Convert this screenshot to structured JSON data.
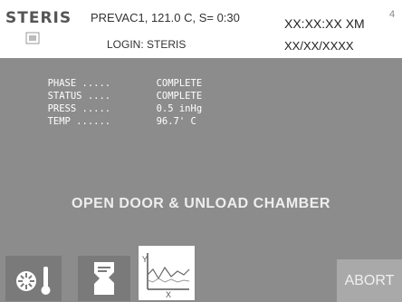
{
  "header": {
    "brand": "STERIS",
    "cycle_info": "PREVAC1, 121.0 C, S= 0:30",
    "login": "LOGIN: STERIS",
    "time": "XX:XX:XX XM",
    "date": "XX/XX/XXXX",
    "page_number": "4"
  },
  "status": {
    "rows": [
      {
        "label": "PHASE .....",
        "value": "COMPLETE"
      },
      {
        "label": "STATUS ....",
        "value": "COMPLETE"
      },
      {
        "label": "PRESS .....",
        "value": "0.5 inHg"
      },
      {
        "label": "TEMP ......",
        "value": "96.7' C"
      }
    ]
  },
  "message": "OPEN DOOR & UNLOAD CHAMBER",
  "buttons": {
    "abort_label": "ABORT"
  },
  "colors": {
    "panel": "#8c8c8c",
    "abort_bg": "#a9a9a9"
  },
  "icons": [
    "brand-mark-icon",
    "temperature-icon",
    "printer-icon",
    "graph-icon"
  ]
}
